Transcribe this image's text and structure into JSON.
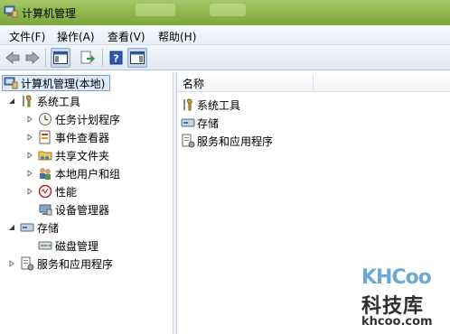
{
  "window": {
    "title": "计算机管理"
  },
  "menu": {
    "items": [
      {
        "label": "文件(F)"
      },
      {
        "label": "操作(A)"
      },
      {
        "label": "查看(V)"
      },
      {
        "label": "帮助(H)"
      }
    ]
  },
  "toolbar": {
    "buttons": [
      "back-icon",
      "forward-icon",
      "show-hide-tree-icon",
      "export-list-icon",
      "help-icon",
      "show-hide-action-pane-icon"
    ]
  },
  "tree": {
    "root": "计算机管理(本地)",
    "items": [
      {
        "label": "系统工具",
        "expanded": true
      },
      {
        "label": "任务计划程序"
      },
      {
        "label": "事件查看器"
      },
      {
        "label": "共享文件夹"
      },
      {
        "label": "本地用户和组"
      },
      {
        "label": "性能"
      },
      {
        "label": "设备管理器"
      },
      {
        "label": "存储",
        "expanded": true
      },
      {
        "label": "磁盘管理"
      },
      {
        "label": "服务和应用程序"
      }
    ]
  },
  "list": {
    "column_header": "名称",
    "rows": [
      {
        "label": "系统工具"
      },
      {
        "label": "存储"
      },
      {
        "label": "服务和应用程序"
      }
    ]
  },
  "watermark": {
    "logo": "KHCoo",
    "name": "科技库",
    "url": "khcoo.com"
  },
  "colors": {
    "titlebar": "#8fb84f",
    "selection": "#dce9f8",
    "selection_border": "#7da2ce",
    "watermark_blue": "#6aa9d6"
  }
}
